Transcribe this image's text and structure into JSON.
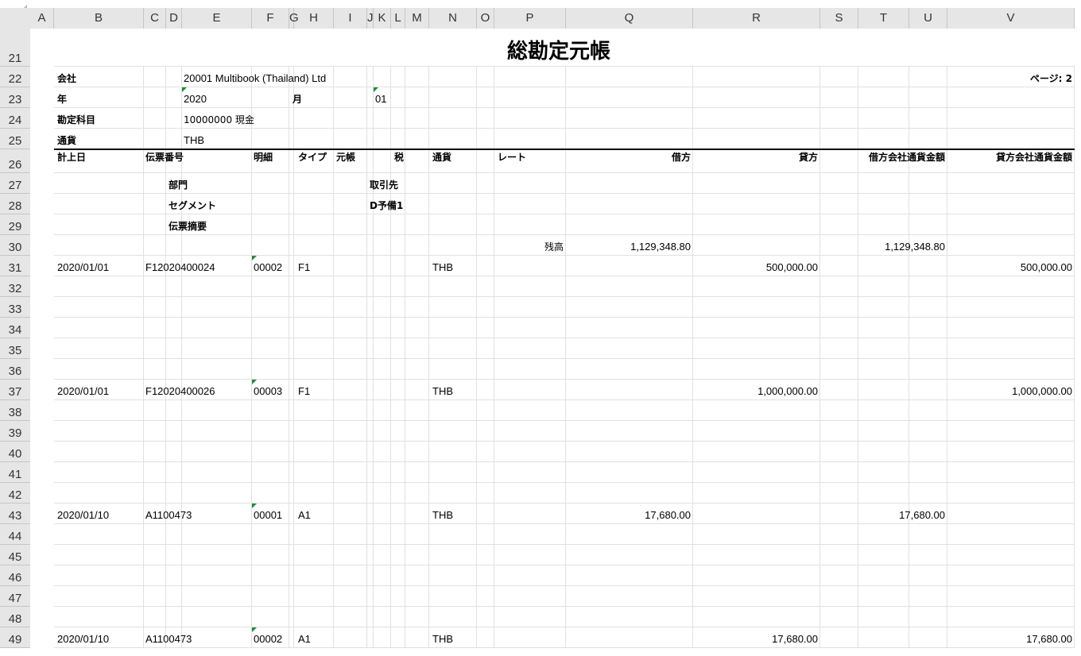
{
  "columns": [
    "A",
    "B",
    "C",
    "D",
    "E",
    "F",
    "G",
    "H",
    "I",
    "J",
    "K",
    "L",
    "M",
    "N",
    "O",
    "P",
    "Q",
    "R",
    "S",
    "T",
    "U",
    "V"
  ],
  "rows": [
    "21",
    "22",
    "23",
    "24",
    "25",
    "26",
    "27",
    "28",
    "29",
    "30",
    "31",
    "32",
    "33",
    "34",
    "35",
    "36",
    "37",
    "38",
    "39",
    "40",
    "41",
    "42",
    "43",
    "44",
    "45",
    "46",
    "47",
    "48",
    "49"
  ],
  "report": {
    "title": "総勘定元帳",
    "page_label": "ページ: 2",
    "company_label": "会社",
    "company_value": "20001 Multibook (Thailand) Ltd",
    "year_label": "年",
    "year_value": "2020",
    "month_label": "月",
    "month_value": "01",
    "account_label": "勘定科目",
    "account_value": "10000000 現金",
    "currency_label": "通貨",
    "currency_value": "THB"
  },
  "headers": {
    "posting_date": "計上日",
    "voucher_no": "伝票番号",
    "detail": "明細",
    "type": "タイプ",
    "ledger": "元帳",
    "tax": "税",
    "currency": "通貨",
    "rate": "レート",
    "debit": "借方",
    "credit": "貸方",
    "debit_company": "借方会社通貨金額",
    "credit_company": "貸方会社通貨金額",
    "department": "部門",
    "partner": "取引先",
    "segment": "セグメント",
    "reserve": "D予備1",
    "summary": "伝票摘要"
  },
  "balance": {
    "label": "残高",
    "debit": "1,129,348.80",
    "debit_company": "1,129,348.80"
  },
  "entries": [
    {
      "date": "2020/01/01",
      "voucher": "F12020400024",
      "detail": "00002",
      "type": "F1",
      "currency": "THB",
      "debit": "",
      "credit": "500,000.00",
      "debit_company": "",
      "credit_company": "500,000.00"
    },
    {
      "date": "2020/01/01",
      "voucher": "F12020400026",
      "detail": "00003",
      "type": "F1",
      "currency": "THB",
      "debit": "",
      "credit": "1,000,000.00",
      "debit_company": "",
      "credit_company": "1,000,000.00"
    },
    {
      "date": "2020/01/10",
      "voucher": "A1100473",
      "detail": "00001",
      "type": "A1",
      "currency": "THB",
      "debit": "17,680.00",
      "credit": "",
      "debit_company": "17,680.00",
      "credit_company": ""
    },
    {
      "date": "2020/01/10",
      "voucher": "A1100473",
      "detail": "00002",
      "type": "A1",
      "currency": "THB",
      "debit": "",
      "credit": "17,680.00",
      "debit_company": "",
      "credit_company": "17,680.00"
    }
  ]
}
